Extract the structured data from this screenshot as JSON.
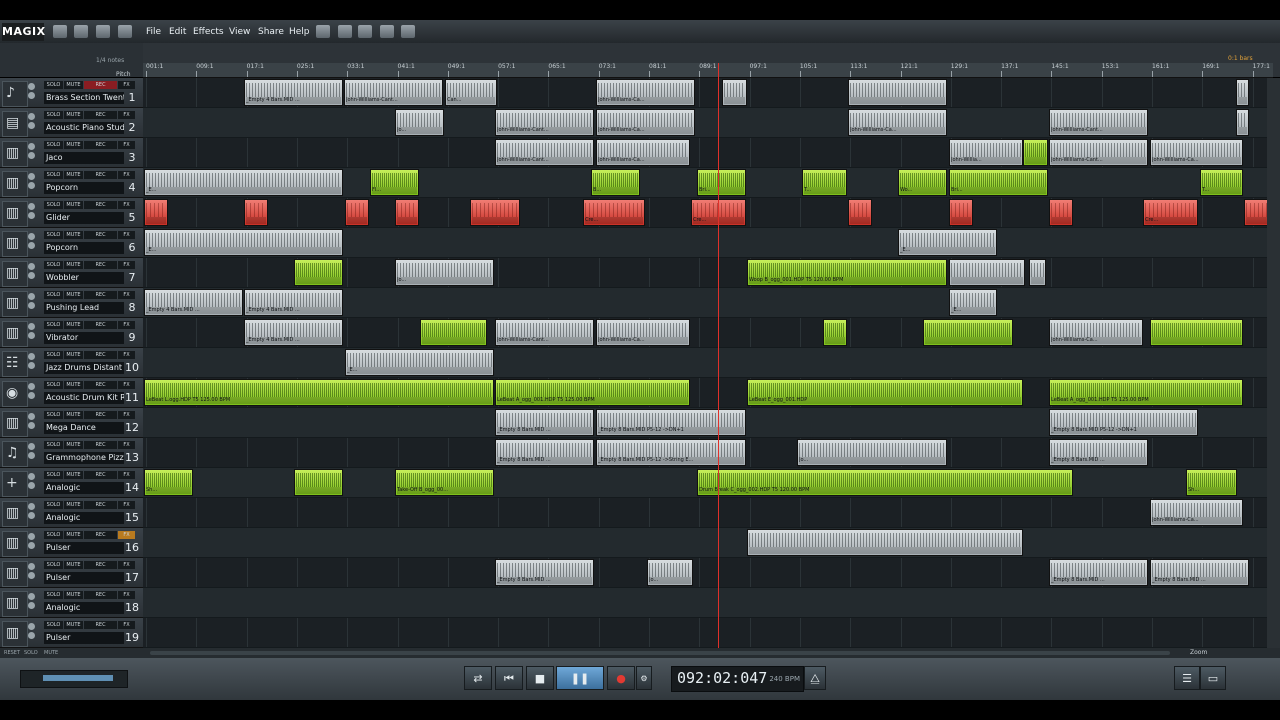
{
  "app": {
    "logo": "MAGIX"
  },
  "menu": [
    "File",
    "Edit",
    "Effects",
    "View",
    "Share",
    "Help"
  ],
  "ruler": {
    "quantize": "1/4 notes",
    "pitch_label": "Pitch",
    "bar_marker": "0:1 bars",
    "ticks": [
      "001:1",
      "009:1",
      "017:1",
      "025:1",
      "033:1",
      "041:1",
      "049:1",
      "057:1",
      "065:1",
      "073:1",
      "081:1",
      "089:1",
      "097:1",
      "105:1",
      "113:1",
      "121:1",
      "129:1",
      "137:1",
      "145:1",
      "153:1",
      "161:1",
      "169:1",
      "177:1"
    ]
  },
  "track_buttons": {
    "solo": "SOLO",
    "mute": "MUTE",
    "rec": "REC",
    "fx": "FX"
  },
  "tracks": [
    {
      "num": "1",
      "name": "Brass Section Twentie",
      "icon": "trumpet-icon"
    },
    {
      "num": "2",
      "name": "Acoustic Piano Studi",
      "icon": "piano-icon"
    },
    {
      "num": "3",
      "name": "Jaco",
      "icon": "midi-keys-icon"
    },
    {
      "num": "4",
      "name": "Popcorn",
      "icon": "midi-keys-icon"
    },
    {
      "num": "5",
      "name": "Glider",
      "icon": "midi-keys-icon"
    },
    {
      "num": "6",
      "name": "Popcorn",
      "icon": "midi-keys-icon"
    },
    {
      "num": "7",
      "name": "Wobbler",
      "icon": "midi-keys-icon"
    },
    {
      "num": "8",
      "name": "Pushing Lead",
      "icon": "midi-keys-icon"
    },
    {
      "num": "9",
      "name": "Vibrator",
      "icon": "midi-keys-icon"
    },
    {
      "num": "10",
      "name": "Jazz Drums Distant",
      "icon": "drums-icon"
    },
    {
      "num": "11",
      "name": "Acoustic Drum Kit Ro",
      "icon": "drum-icon"
    },
    {
      "num": "12",
      "name": "Mega Dance",
      "icon": "midi-keys-icon"
    },
    {
      "num": "13",
      "name": "Grammophone Pizz",
      "icon": "instrument-icon"
    },
    {
      "num": "14",
      "name": "Analogic",
      "icon": "plus-icon"
    },
    {
      "num": "15",
      "name": "Analogic",
      "icon": "midi-keys-icon"
    },
    {
      "num": "16",
      "name": "Pulser",
      "icon": "midi-keys-icon"
    },
    {
      "num": "17",
      "name": "Pulser",
      "icon": "midi-keys-icon"
    },
    {
      "num": "18",
      "name": "Analogic",
      "icon": "midi-keys-icon"
    },
    {
      "num": "19",
      "name": "Pulser",
      "icon": "midi-keys-icon"
    }
  ],
  "clips": [
    {
      "t": 0,
      "a": 101,
      "b": 200,
      "c": "gray",
      "l": "_Empty 4 Bars.MID ..."
    },
    {
      "t": 0,
      "a": 201,
      "b": 300,
      "c": "gray",
      "l": "John-Williams-Cant..."
    },
    {
      "t": 0,
      "a": 302,
      "b": 354,
      "c": "gray",
      "l": "Can..."
    },
    {
      "t": 0,
      "a": 453,
      "b": 552,
      "c": "gray",
      "l": "John-Williams-Ca..."
    },
    {
      "t": 0,
      "a": 579,
      "b": 604,
      "c": "gray",
      "l": ""
    },
    {
      "t": 0,
      "a": 705,
      "b": 804,
      "c": "gray",
      "l": ""
    },
    {
      "t": 0,
      "a": 1093,
      "b": 1106,
      "c": "gray",
      "l": ""
    },
    {
      "t": 1,
      "a": 252,
      "b": 301,
      "c": "gray",
      "l": "Jo..."
    },
    {
      "t": 1,
      "a": 352,
      "b": 451,
      "c": "gray",
      "l": "John-Williams-Cant..."
    },
    {
      "t": 1,
      "a": 453,
      "b": 552,
      "c": "gray",
      "l": "John-Williams-Ca..."
    },
    {
      "t": 1,
      "a": 705,
      "b": 804,
      "c": "gray",
      "l": "John-Williams-Ca..."
    },
    {
      "t": 1,
      "a": 906,
      "b": 1005,
      "c": "gray",
      "l": "John-Williams-Cant..."
    },
    {
      "t": 1,
      "a": 1093,
      "b": 1106,
      "c": "gray",
      "l": ""
    },
    {
      "t": 2,
      "a": 352,
      "b": 451,
      "c": "gray",
      "l": "John-Williams-Cant..."
    },
    {
      "t": 2,
      "a": 453,
      "b": 547,
      "c": "gray",
      "l": "John-Williams-Ca..."
    },
    {
      "t": 2,
      "a": 806,
      "b": 880,
      "c": "gray",
      "l": "John-Willia..."
    },
    {
      "t": 2,
      "a": 880,
      "b": 905,
      "c": "green",
      "l": ""
    },
    {
      "t": 2,
      "a": 906,
      "b": 1005,
      "c": "gray",
      "l": "John-Williams-Cant..."
    },
    {
      "t": 2,
      "a": 1007,
      "b": 1100,
      "c": "gray",
      "l": "John-Williams-Ca..."
    },
    {
      "t": 3,
      "a": 1,
      "b": 200,
      "c": "gray",
      "l": "_E..."
    },
    {
      "t": 3,
      "a": 227,
      "b": 276,
      "c": "green",
      "l": "Fl..."
    },
    {
      "t": 3,
      "a": 448,
      "b": 497,
      "c": "green",
      "l": "B..."
    },
    {
      "t": 3,
      "a": 554,
      "b": 603,
      "c": "green",
      "l": "Bri..."
    },
    {
      "t": 3,
      "a": 659,
      "b": 704,
      "c": "green",
      "l": "T..."
    },
    {
      "t": 3,
      "a": 755,
      "b": 804,
      "c": "green",
      "l": "Wo..."
    },
    {
      "t": 3,
      "a": 806,
      "b": 905,
      "c": "green",
      "l": "Bri..."
    },
    {
      "t": 3,
      "a": 1057,
      "b": 1100,
      "c": "green",
      "l": "T..."
    },
    {
      "t": 4,
      "a": 1,
      "b": 25,
      "c": "red",
      "l": ""
    },
    {
      "t": 4,
      "a": 101,
      "b": 125,
      "c": "red",
      "l": ""
    },
    {
      "t": 4,
      "a": 202,
      "b": 226,
      "c": "red",
      "l": ""
    },
    {
      "t": 4,
      "a": 252,
      "b": 276,
      "c": "red",
      "l": ""
    },
    {
      "t": 4,
      "a": 327,
      "b": 377,
      "c": "red",
      "l": ""
    },
    {
      "t": 4,
      "a": 440,
      "b": 502,
      "c": "red",
      "l": "Cre..."
    },
    {
      "t": 4,
      "a": 548,
      "b": 603,
      "c": "red",
      "l": "Cre..."
    },
    {
      "t": 4,
      "a": 705,
      "b": 729,
      "c": "red",
      "l": ""
    },
    {
      "t": 4,
      "a": 806,
      "b": 830,
      "c": "red",
      "l": ""
    },
    {
      "t": 4,
      "a": 906,
      "b": 930,
      "c": "red",
      "l": ""
    },
    {
      "t": 4,
      "a": 1000,
      "b": 1055,
      "c": "red",
      "l": "Cre..."
    },
    {
      "t": 4,
      "a": 1101,
      "b": 1126,
      "c": "red",
      "l": ""
    },
    {
      "t": 5,
      "a": 1,
      "b": 200,
      "c": "gray",
      "l": "_E..."
    },
    {
      "t": 5,
      "a": 755,
      "b": 854,
      "c": "gray",
      "l": "_E..."
    },
    {
      "t": 6,
      "a": 151,
      "b": 200,
      "c": "green",
      "l": ""
    },
    {
      "t": 6,
      "a": 252,
      "b": 351,
      "c": "gray",
      "l": "Jo..."
    },
    {
      "t": 6,
      "a": 604,
      "b": 804,
      "c": "green",
      "l": "Woop B_ogg_001.HDP  T5  120.00 BPM"
    },
    {
      "t": 6,
      "a": 806,
      "b": 882,
      "c": "gray",
      "l": ""
    },
    {
      "t": 6,
      "a": 886,
      "b": 903,
      "c": "gray",
      "l": ""
    },
    {
      "t": 7,
      "a": 1,
      "b": 100,
      "c": "gray",
      "l": "_Empty 4 Bars.MID ..."
    },
    {
      "t": 7,
      "a": 101,
      "b": 200,
      "c": "gray",
      "l": "_Empty 4 Bars.MID ..."
    },
    {
      "t": 7,
      "a": 806,
      "b": 854,
      "c": "gray",
      "l": "_E..."
    },
    {
      "t": 8,
      "a": 101,
      "b": 200,
      "c": "gray",
      "l": "_Empty 4 Bars.MID ..."
    },
    {
      "t": 8,
      "a": 277,
      "b": 344,
      "c": "green",
      "l": ""
    },
    {
      "t": 8,
      "a": 352,
      "b": 451,
      "c": "gray",
      "l": "John-Williams-Cant..."
    },
    {
      "t": 8,
      "a": 453,
      "b": 547,
      "c": "gray",
      "l": "John-Williams-Ca..."
    },
    {
      "t": 8,
      "a": 680,
      "b": 704,
      "c": "green",
      "l": ""
    },
    {
      "t": 8,
      "a": 780,
      "b": 870,
      "c": "green",
      "l": ""
    },
    {
      "t": 8,
      "a": 906,
      "b": 1000,
      "c": "gray",
      "l": "John-Williams-Ca..."
    },
    {
      "t": 8,
      "a": 1007,
      "b": 1100,
      "c": "green",
      "l": ""
    },
    {
      "t": 9,
      "a": 202,
      "b": 351,
      "c": "gray",
      "l": "_E..."
    },
    {
      "t": 10,
      "a": 1,
      "b": 351,
      "c": "green",
      "l": "LeBeat L.ogg.HDP  T5  125.00 BPM"
    },
    {
      "t": 10,
      "a": 352,
      "b": 547,
      "c": "green",
      "l": "LeBeat A_ogg_001.HDP  T5  125.00 BPM"
    },
    {
      "t": 10,
      "a": 604,
      "b": 880,
      "c": "green",
      "l": "LeBeat E_ogg_001.HDP"
    },
    {
      "t": 10,
      "a": 906,
      "b": 1100,
      "c": "green",
      "l": "LeBeat A_ogg_001.HDP  T5  125.00 BPM"
    },
    {
      "t": 11,
      "a": 352,
      "b": 451,
      "c": "gray",
      "l": "_Empty 8 Bars.MID ..."
    },
    {
      "t": 11,
      "a": 453,
      "b": 603,
      "c": "gray",
      "l": "_Empty 8 Bars.MID  P5-12 ->DN+1"
    },
    {
      "t": 11,
      "a": 906,
      "b": 1055,
      "c": "gray",
      "l": "_Empty 8 Bars.MID  P5-12 ->DN+1"
    },
    {
      "t": 12,
      "a": 352,
      "b": 451,
      "c": "gray",
      "l": "_Empty 8 Bars.MID ..."
    },
    {
      "t": 12,
      "a": 453,
      "b": 603,
      "c": "gray",
      "l": "_Empty 8 Bars.MID  P5-12 ->String E..."
    },
    {
      "t": 12,
      "a": 654,
      "b": 804,
      "c": "gray",
      "l": "Jo..."
    },
    {
      "t": 12,
      "a": 906,
      "b": 1005,
      "c": "gray",
      "l": "_Empty 8 Bars.MID ..."
    },
    {
      "t": 13,
      "a": 1,
      "b": 50,
      "c": "green",
      "l": "Sh..."
    },
    {
      "t": 13,
      "a": 151,
      "b": 200,
      "c": "green",
      "l": ""
    },
    {
      "t": 13,
      "a": 252,
      "b": 351,
      "c": "green",
      "l": "Take-Off B_ogg_00..."
    },
    {
      "t": 13,
      "a": 554,
      "b": 930,
      "c": "green",
      "l": "Drum Break C_ogg_002.HDP  T5  120.00 BPM"
    },
    {
      "t": 13,
      "a": 1043,
      "b": 1094,
      "c": "green",
      "l": "Sh..."
    },
    {
      "t": 14,
      "a": 1007,
      "b": 1100,
      "c": "gray",
      "l": "John-Williams-Ca..."
    },
    {
      "t": 15,
      "a": 604,
      "b": 880,
      "c": "gray",
      "l": ""
    },
    {
      "t": 16,
      "a": 352,
      "b": 451,
      "c": "gray",
      "l": "_Empty 8 Bars.MID ..."
    },
    {
      "t": 16,
      "a": 504,
      "b": 550,
      "c": "gray",
      "l": "Jo..."
    },
    {
      "t": 16,
      "a": 906,
      "b": 1005,
      "c": "gray",
      "l": "_Empty 8 Bars.MID ..."
    },
    {
      "t": 16,
      "a": 1007,
      "b": 1106,
      "c": "gray",
      "l": "_Empty 8 Bars.MID ..."
    }
  ],
  "transport": {
    "time": "092:02:047",
    "bpm": "240 BPM"
  },
  "zoom_label": "Zoom",
  "footer": [
    "RESET",
    "SOLO",
    "MUTE"
  ]
}
